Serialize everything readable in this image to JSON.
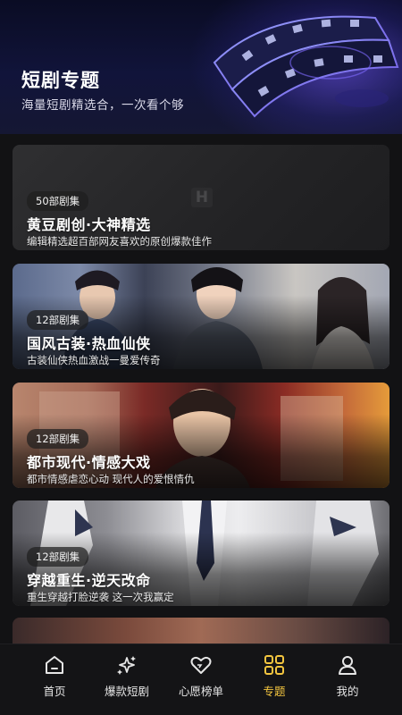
{
  "header": {
    "title": "短剧专题",
    "subtitle": "海量短剧精选合，一次看个够"
  },
  "cards": [
    {
      "badge": "50部剧集",
      "title": "黄豆剧创·大神精选",
      "desc": "编辑精选超百部网友喜欢的原创爆款佳作",
      "watermark": "H"
    },
    {
      "badge": "12部剧集",
      "title": "国风古装·热血仙侠",
      "desc": "古装仙侠热血激战一曼爱传奇"
    },
    {
      "badge": "12部剧集",
      "title": "都市现代·情感大戏",
      "desc": "都市情感虐恋心动 现代人的爱恨情仇"
    },
    {
      "badge": "12部剧集",
      "title": "穿越重生·逆天改命",
      "desc": "重生穿越打脸逆袭 这一次我赢定"
    }
  ],
  "nav": [
    {
      "label": "首页",
      "icon": "home-icon",
      "active": false
    },
    {
      "label": "爆款短剧",
      "icon": "sparkle-icon",
      "active": false
    },
    {
      "label": "心愿榜单",
      "icon": "heart-icon",
      "active": false
    },
    {
      "label": "专题",
      "icon": "grid-icon",
      "active": true
    },
    {
      "label": "我的",
      "icon": "profile-icon",
      "active": false
    }
  ],
  "colors": {
    "accent": "#f3c53f",
    "background": "#121214",
    "nav_text": "#e6e6e6"
  }
}
